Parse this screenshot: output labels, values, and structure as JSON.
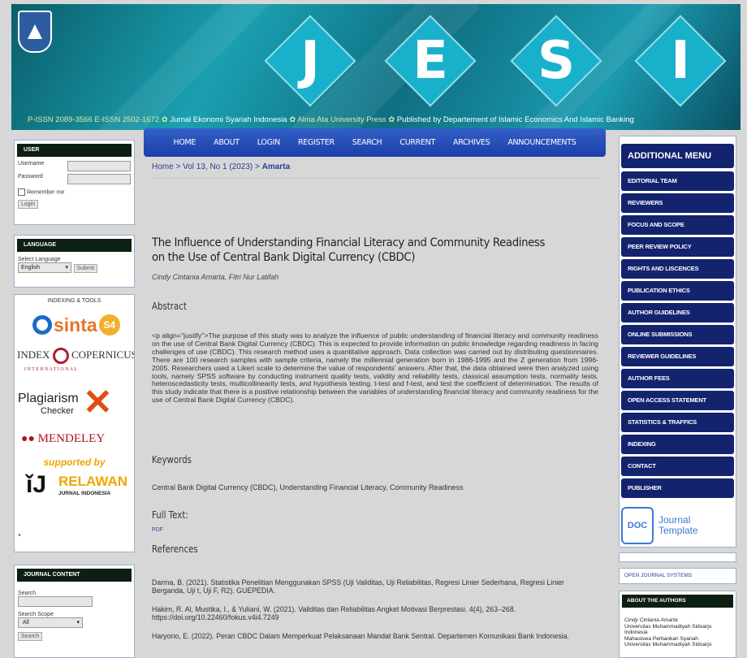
{
  "header": {
    "letters": [
      "J",
      "E",
      "S",
      "I"
    ],
    "issn": "P-ISSN 2089-3566 E-ISSN 2502-1672",
    "journal_name": "Jurnal Ekonomi Syariah Indonesia",
    "press": "Alma Ata University Press",
    "publisher_line": "Published by Departement of Islamic Economics And Islamic Banking"
  },
  "nav": [
    "HOME",
    "ABOUT",
    "LOGIN",
    "REGISTER",
    "SEARCH",
    "CURRENT",
    "ARCHIVES",
    "ANNOUNCEMENTS"
  ],
  "breadcrumb": {
    "home": "Home",
    "sep": " > ",
    "issue": "Vol 13, No 1 (2023)",
    "current": "Amarta"
  },
  "article": {
    "title": "The Influence of Understanding Financial Literacy and Community Readiness on the Use of Central Bank Digital Currency (CBDC)",
    "authors": "Cindy Cintania Amarta, Fitri Nur Latifah",
    "abstract_heading": "Abstract",
    "abstract": "<p align=\"justify\">The purpose of this study was to analyze the influence of public understanding of financial literacy and community readiness on the use of Central Bank Digital Currency (CBDC). This is expected to provide information on public knowledge regarding readiness in facing challenges of use (CBDC). This research method uses a quantitative approach. Data collection was carried out by distributing questionnaires. There are 100 research samples with sample criteria, namely the millennial generation born in 1986-1995 and the Z generation from 1996-2005. Researchers used a Likert scale to determine the value of respondents' answers. After that, the data obtained were then analyzed using tools, namely SPSS software by conducting instrument quality tests, validity and reliability tests, classical assumption tests, normality tests, heteroscedasticity tests, multicollinearity tests, and hypothesis testing. t-test and f-test, and test the coefficient of determination. The results of this study indicate that there is a positive relationship between the variables of understanding financial literacy and community readiness for the use of Central Bank Digital Currency (CBDC).",
    "keywords_heading": "Keywords",
    "keywords": "Central Bank Digital Currency (CBDC), Understanding Financial Literacy, Community Readiness",
    "fulltext_heading": "Full Text:",
    "pdf": "PDF",
    "references_heading": "References",
    "references": [
      "Darma, B. (2021). Statistika Penelitian Menggunakan SPSS (Uji Validitas, Uji Reliabilitas, Regresi Linier Sederhana, Regresi Linier Berganda, Uji t, Uji F, R2). GUEPEDIA.",
      "Hakim, R. Al, Mustika, I., & Yuliani, W. (2021). Validitas dan Reliabilitas Angket Motivasi Berprestasi. 4(4), 263–268. https://doi.org/10.22460/fokus.v4i4.7249",
      "Haryono, E. (2022). Peran CBDC Dalam Memperkuat Pelaksanaan Mandat Bank Sentral. Departemen Komunikasi Bank Indonesia."
    ]
  },
  "user_box": {
    "title": "USER",
    "username": "Username",
    "password": "Password",
    "remember": "Remember me",
    "login": "Login"
  },
  "language_box": {
    "title": "LANGUAGE",
    "label": "Select Language",
    "selected": "English",
    "submit": "Submit"
  },
  "indexing": {
    "title": "INDEXING & TOOLS",
    "sinta": "sinta",
    "sinta_badge": "S4",
    "index_left": "INDEX",
    "index_right": "COPERNICUS",
    "international": "I N T E R N A T I O N A L",
    "plagiarism": "Plagiarism",
    "checker": "Checker",
    "mendeley": "MENDELEY",
    "supported": "supported by",
    "relawan": "RELAWAN",
    "rji": "JURNAL INDONESIA"
  },
  "journal_content": {
    "title": "JOURNAL CONTENT",
    "search": "Search",
    "scope": "Search Scope",
    "scope_value": "All",
    "search_btn": "Search"
  },
  "right_menu": {
    "title": "ADDITIONAL MENU",
    "items": [
      "EDITORIAL TEAM",
      "REVIEWERS",
      "FOCUS AND SCOPE",
      "PEER REVIEW POLICY",
      "RIGHTS AND LISCENCES",
      "PUBLICATION ETHICS",
      "AUTHOR GUIDELINES",
      "ONLINE SUBMISSIONS",
      "REVIEWER GUIDELINES",
      "AUTHOR FEES",
      "OPEN ACCESS STATEMENT",
      "STATISTICS & TRAFFICS",
      "INDEXING",
      "CONTACT",
      "PUBLISHER"
    ],
    "template_doc": "DOC",
    "template_label_1": "Journal",
    "template_label_2": "Template"
  },
  "ojs": "OPEN JOURNAL SYSTEMS",
  "about_authors": {
    "title": "ABOUT THE AUTHORS",
    "name": "Cindy Cintania Amarta",
    "line1": "Universitas Muhammadiyah Sidoarjo",
    "line2": "Indonesia",
    "line3": "Mahasiswa Perbankan Syariah",
    "line4": "Universitas Muhammadiyah Sidoarjo"
  },
  "colors": {
    "nav": "#2548b8",
    "menu": "#13236e",
    "box_title": "#0d1f13"
  }
}
